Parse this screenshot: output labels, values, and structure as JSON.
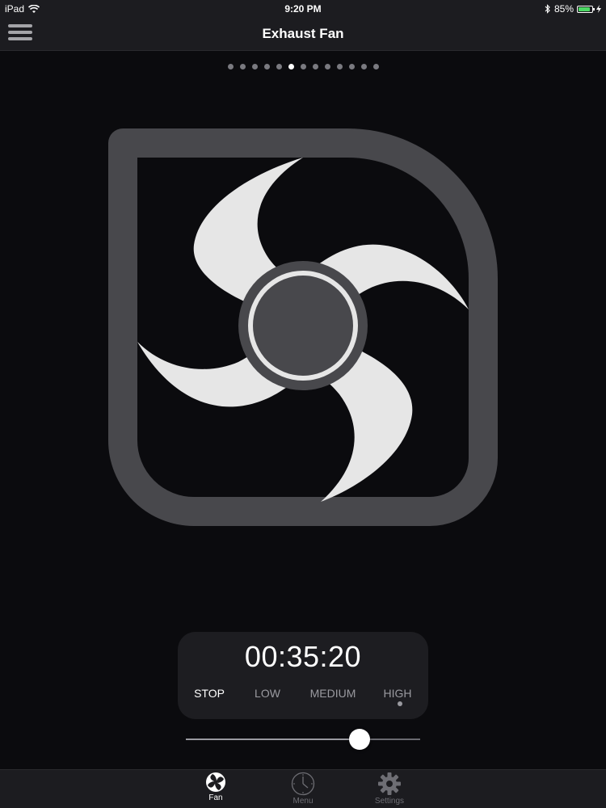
{
  "status_bar": {
    "device": "iPad",
    "time": "9:20 PM",
    "battery_percent": "85%",
    "battery_level": 0.85,
    "wifi_icon": "wifi-icon",
    "bluetooth_icon": "bluetooth-icon"
  },
  "nav": {
    "title": "Exhaust Fan",
    "menu_icon": "hamburger-menu-icon"
  },
  "pager": {
    "count": 13,
    "active_index": 5
  },
  "fan": {
    "icon": "exhaust-fan-icon",
    "frame_color": "#48484c",
    "blade_color": "#e6e6e6",
    "hub_color": "#48484c"
  },
  "controls": {
    "timer": "00:35:20",
    "speeds": [
      {
        "label": "STOP",
        "selected": true
      },
      {
        "label": "LOW",
        "selected": false
      },
      {
        "label": "MEDIUM",
        "selected": false
      },
      {
        "label": "HIGH",
        "selected": false
      }
    ],
    "indicator_on": "HIGH",
    "slider_value": 0.74
  },
  "tabs": [
    {
      "label": "Fan",
      "icon": "fan-icon",
      "active": true
    },
    {
      "label": "Menu",
      "icon": "clock-icon",
      "active": false
    },
    {
      "label": "Settings",
      "icon": "gear-icon",
      "active": false
    }
  ]
}
